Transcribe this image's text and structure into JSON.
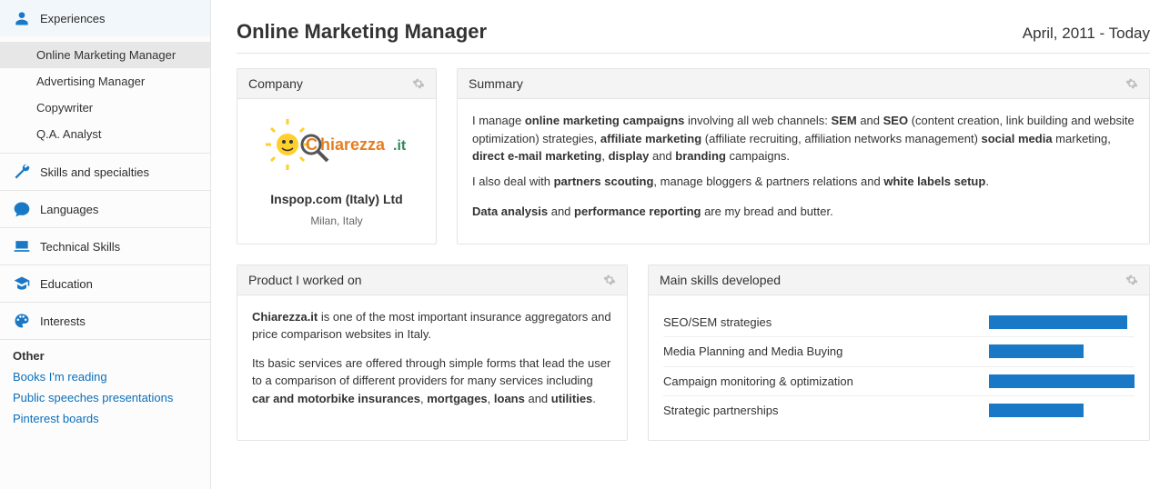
{
  "sidebar": {
    "sections": [
      {
        "id": "experiences",
        "label": "Experiences",
        "icon": "person-icon"
      },
      {
        "id": "skills",
        "label": "Skills and specialties",
        "icon": "wrench-icon"
      },
      {
        "id": "languages",
        "label": "Languages",
        "icon": "bubble-icon"
      },
      {
        "id": "technical",
        "label": "Technical Skills",
        "icon": "laptop-icon"
      },
      {
        "id": "education",
        "label": "Education",
        "icon": "grad-icon"
      },
      {
        "id": "interests",
        "label": "Interests",
        "icon": "palette-icon"
      }
    ],
    "experiences": [
      "Online Marketing Manager",
      "Advertising Manager",
      "Copywriter",
      "Q.A. Analyst"
    ],
    "other_heading": "Other",
    "other_links": [
      "Books I'm reading",
      "Public speeches presentations",
      "Pinterest boards"
    ]
  },
  "header": {
    "title": "Online Marketing Manager",
    "date_from": "April, 2011",
    "date_sep": " - ",
    "date_to": "Today"
  },
  "company_card": {
    "heading": "Company",
    "logo_text": "Chiarezza.it",
    "name": "Inspop.com (Italy) Ltd",
    "location": "Milan, Italy"
  },
  "summary_card": {
    "heading": "Summary",
    "p1_pre": "I manage ",
    "p1_b1": "online marketing campaigns",
    "p1_mid1": " involving all web channels: ",
    "p1_b2": "SEM",
    "p1_and": " and ",
    "p1_b3": "SEO",
    "p1_mid2": " (content creation, link building and website optimization) strategies, ",
    "p1_b4": "affiliate marketing",
    "p1_mid3": " (affiliate recruiting, affiliation networks management) ",
    "p1_b5": "social media",
    "p1_mid4": " marketing, ",
    "p1_b6": "direct e-mail marketing",
    "p1_mid5": ", ",
    "p1_b7": "display",
    "p1_mid6": " and ",
    "p1_b8": "branding",
    "p1_mid7": " campaigns.",
    "p2_pre": "I also deal with ",
    "p2_b1": "partners scouting",
    "p2_mid": ", manage bloggers & partners relations and ",
    "p2_b2": "white labels setup",
    "p2_end": ".",
    "p3_b1": "Data analysis",
    "p3_and": " and ",
    "p3_b2": "performance reporting",
    "p3_end": " are my bread and butter."
  },
  "product_card": {
    "heading": "Product I worked on",
    "p1_b": "Chiarezza.it",
    "p1_rest": " is one of the most important insurance aggregators and price comparison websites in Italy.",
    "p2_pre": "Its basic services are offered through simple forms that lead the user to a comparison of different providers for many services including ",
    "p2_b1": "car and motorbike insurances",
    "p2_sep1": ", ",
    "p2_b2": "mortgages",
    "p2_sep2": ", ",
    "p2_b3": "loans",
    "p2_and": " and ",
    "p2_b4": "utilities",
    "p2_end": "."
  },
  "skills_card": {
    "heading": "Main skills developed",
    "rows": [
      {
        "name": "SEO/SEM strategies",
        "pct": 95
      },
      {
        "name": "Media Planning and Media Buying",
        "pct": 65
      },
      {
        "name": "Campaign monitoring & optimization",
        "pct": 100
      },
      {
        "name": "Strategic partnerships",
        "pct": 65
      }
    ]
  },
  "chart_data": {
    "type": "bar",
    "title": "Main skills developed",
    "xlabel": "",
    "ylabel": "",
    "ylim": [
      0,
      100
    ],
    "categories": [
      "SEO/SEM strategies",
      "Media Planning and Media Buying",
      "Campaign monitoring & optimization",
      "Strategic partnerships"
    ],
    "values": [
      95,
      65,
      100,
      65
    ]
  },
  "colors": {
    "accent": "#1a79c7",
    "link": "#0b6fbb",
    "logo_orange": "#f39c12"
  }
}
